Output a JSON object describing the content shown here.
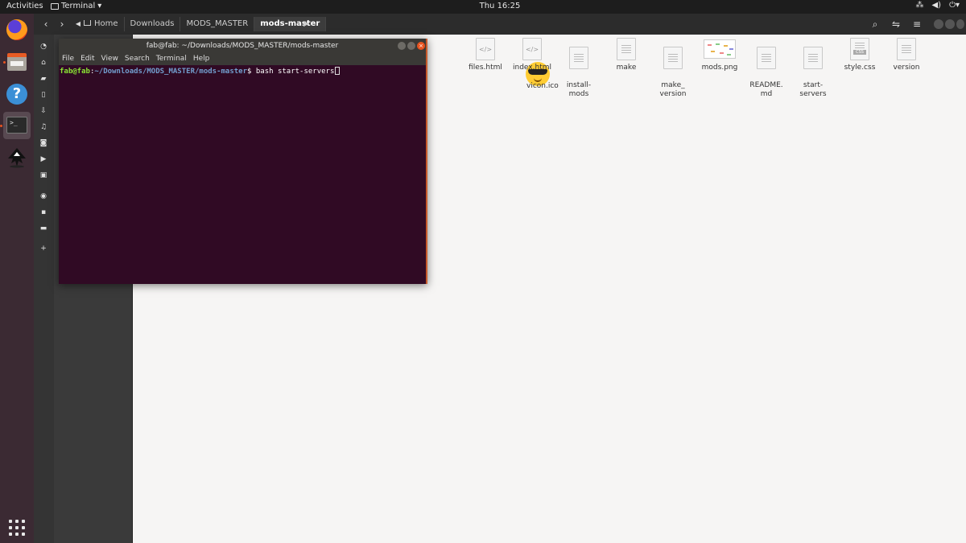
{
  "topbar": {
    "activities": "Activities",
    "app_name": "Terminal",
    "clock": "Thu 16:25"
  },
  "nautilus": {
    "breadcrumbs": [
      "Home",
      "Downloads",
      "MODS_MASTER",
      "mods-master"
    ],
    "files": [
      {
        "name": "favicon.ico",
        "shown_label": "vicon.ico"
      },
      {
        "name": "files.html"
      },
      {
        "name": "index.html"
      },
      {
        "name": "install-\nmods"
      },
      {
        "name": "make"
      },
      {
        "name": "make_\nversion"
      },
      {
        "name": "mods.png"
      },
      {
        "name": "README.\nmd"
      },
      {
        "name": "start-\nservers"
      },
      {
        "name": "style.css"
      },
      {
        "name": "version"
      }
    ]
  },
  "terminal": {
    "title": "fab@fab: ~/Downloads/MODS_MASTER/mods-master",
    "menu": [
      "File",
      "Edit",
      "View",
      "Search",
      "Terminal",
      "Help"
    ],
    "prompt_user": "fab@fab",
    "prompt_path": "~/Downloads/MODS_MASTER/mods-master",
    "prompt_symbol": "$",
    "command": "bash start-servers",
    "colors": {
      "background": "#300a24",
      "user": "#8ae234",
      "path": "#729fcf"
    }
  },
  "icons": {
    "close_glyph": "×",
    "css_tag": "CSS"
  }
}
